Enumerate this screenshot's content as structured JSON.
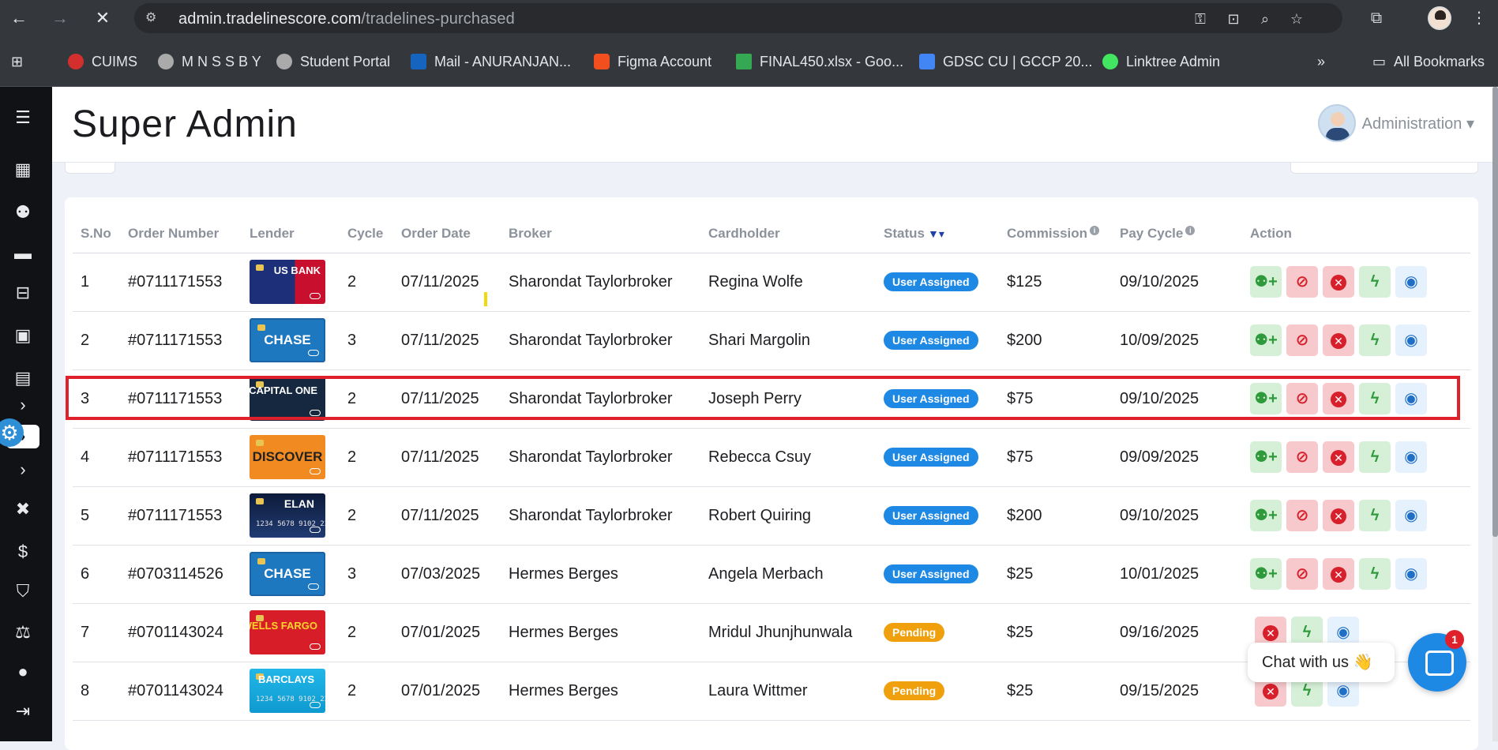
{
  "browser": {
    "url_domain": "admin.tradelinescore.com",
    "url_path": "/tradelines-purchased",
    "bookmarks": [
      {
        "label": "CUIMS",
        "color": "#d32f2f"
      },
      {
        "label": "M N S S B Y",
        "color": "#aaaaaa"
      },
      {
        "label": "Student Portal",
        "color": "#aaaaaa"
      },
      {
        "label": "Mail - ANURANJAN...",
        "color": "#1565c0"
      },
      {
        "label": "Figma Account",
        "color": "#f24e1e"
      },
      {
        "label": "FINAL450.xlsx - Goo...",
        "color": "#34a853"
      },
      {
        "label": "GDSC CU | GCCP 20...",
        "color": "#4285f4"
      },
      {
        "label": "Linktree Admin",
        "color": "#43e660"
      }
    ],
    "all_bookmarks": "All Bookmarks"
  },
  "header": {
    "title": "Super Admin",
    "admin_label": "Administration ▾"
  },
  "table": {
    "headers": [
      "S.No",
      "Order Number",
      "Lender",
      "Cycle",
      "Order Date",
      "Broker",
      "Cardholder",
      "Status",
      "Commission",
      "Pay Cycle",
      "Action"
    ],
    "rows": [
      {
        "sno": "1",
        "order": "#0711171553",
        "lender": "US BANK",
        "cycle": "2",
        "date": "07/11/2025",
        "broker": "Sharondat Taylorbroker",
        "holder": "Regina Wolfe",
        "status": "User Assigned",
        "commission": "$125",
        "pay": "09/10/2025"
      },
      {
        "sno": "2",
        "order": "#0711171553",
        "lender": "CHASE",
        "cycle": "3",
        "date": "07/11/2025",
        "broker": "Sharondat Taylorbroker",
        "holder": "Shari Margolin",
        "status": "User Assigned",
        "commission": "$200",
        "pay": "10/09/2025"
      },
      {
        "sno": "3",
        "order": "#0711171553",
        "lender": "CAPITAL ONE",
        "cycle": "2",
        "date": "07/11/2025",
        "broker": "Sharondat Taylorbroker",
        "holder": "Joseph Perry",
        "status": "User Assigned",
        "commission": "$75",
        "pay": "09/10/2025"
      },
      {
        "sno": "4",
        "order": "#0711171553",
        "lender": "DISCOVER",
        "cycle": "2",
        "date": "07/11/2025",
        "broker": "Sharondat Taylorbroker",
        "holder": "Rebecca Csuy",
        "status": "User Assigned",
        "commission": "$75",
        "pay": "09/09/2025"
      },
      {
        "sno": "5",
        "order": "#0711171553",
        "lender": "ELAN",
        "cycle": "2",
        "date": "07/11/2025",
        "broker": "Sharondat Taylorbroker",
        "holder": "Robert Quiring",
        "status": "User Assigned",
        "commission": "$200",
        "pay": "09/10/2025"
      },
      {
        "sno": "6",
        "order": "#0703114526",
        "lender": "CHASE",
        "cycle": "3",
        "date": "07/03/2025",
        "broker": "Hermes Berges",
        "holder": "Angela Merbach",
        "status": "User Assigned",
        "commission": "$25",
        "pay": "10/01/2025"
      },
      {
        "sno": "7",
        "order": "#0701143024",
        "lender": "WELLS FARGO",
        "cycle": "2",
        "date": "07/01/2025",
        "broker": "Hermes Berges",
        "holder": "Mridul Jhunjhunwala",
        "status": "Pending",
        "commission": "$25",
        "pay": "09/16/2025"
      },
      {
        "sno": "8",
        "order": "#0701143024",
        "lender": "BARCLAYS",
        "cycle": "2",
        "date": "07/01/2025",
        "broker": "Hermes Berges",
        "holder": "Laura Wittmer",
        "status": "Pending",
        "commission": "$25",
        "pay": "09/15/2025"
      }
    ]
  },
  "chat": {
    "label": "Chat with us 👋",
    "badge": "1"
  },
  "colors": {
    "accent": "#1e88e5",
    "pending": "#f0a00c",
    "highlight": "#e0202a"
  }
}
